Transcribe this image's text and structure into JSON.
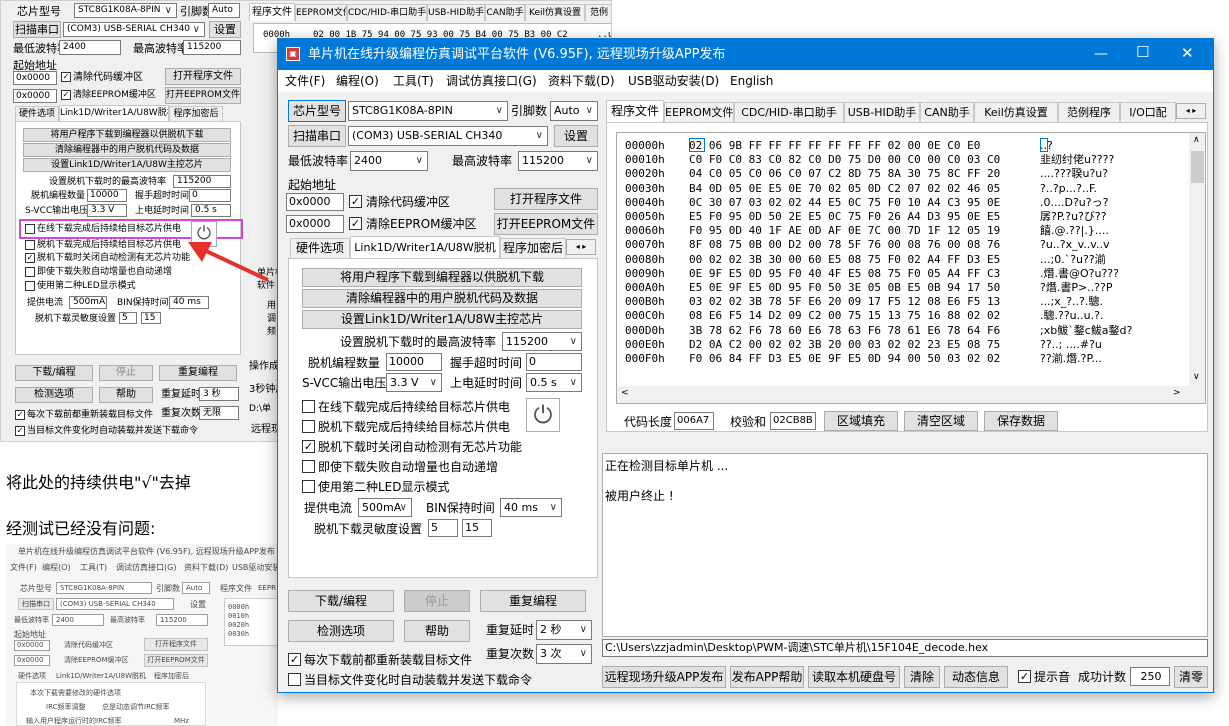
{
  "colors": {
    "accent": "#0078d7",
    "highlight": "#d646d6",
    "arrow": "#e8302a",
    "bg": "#f0f0f0"
  },
  "bgwin": {
    "chip_label": "芯片型号",
    "chip_value": "STC8G1K08A-8PIN",
    "pin_label": "引脚数",
    "pin_value": "Auto",
    "settings": "设置",
    "scan_port": "扫描串口",
    "port": "(COM3) USB-SERIAL CH340",
    "min_baud_label": "最低波特率",
    "min_baud": "2400",
    "max_baud_label": "最高波特率",
    "max_baud": "115200",
    "start_addr": "起始地址",
    "addr1": "0x0000",
    "clear_code": "清除代码缓冲区",
    "open_prog": "打开程序文件",
    "addr2": "0x0000",
    "clear_eeprom": "清除EEPROM缓冲区",
    "open_eeprom": "打开EEPROM文件",
    "tabs": [
      "硬件选项",
      "Link1D/Writer1A/U8W脱机",
      "程序加密后"
    ],
    "btn1": "将用户程序下载到编程器以供脱机下载",
    "btn2": "清除编程器中的用户脱机代码及数据",
    "btn3": "设置Link1D/Writer1A/U8W主控芯片",
    "max_baud_offline": "设置脱机下载时的最高波特率",
    "max_baud_offline_v": "115200",
    "off_count": "脱机编程数量",
    "off_count_v": "10000",
    "timeout": "握手超时时间",
    "timeout_v": "0",
    "svcc": "S-VCC输出电压",
    "svcc_v": "3.3 V",
    "updelay": "上电延时时间",
    "updelay_v": "0.5 s",
    "opt1": "在线下载完成后持续给目标芯片供电",
    "opt2": "脱机下载完成后持续给目标芯片供电",
    "opt3": "脱机下载时关闭自动检测有无芯片功能",
    "opt4": "即使下载失败自动增量也自动递增",
    "opt5": "使用第二种LED显示模式",
    "current": "提供电流",
    "current_v": "500mA",
    "bin_hold": "BIN保持时间",
    "bin_hold_v": "40 ms",
    "sens": "脱机下载灵敏度设置",
    "sens1": "5",
    "sens2": "15",
    "download": "下载/编程",
    "stop": "停止",
    "reprog": "重复编程",
    "check": "检测选项",
    "help": "帮助",
    "redelay": "重复延时",
    "redelay_v": "3 秒",
    "recount": "重复次数",
    "recount_v": "无限",
    "reload": "每次下载前都重新装载目标文件",
    "autosend": "当目标文件变化时自动装载并发送下载命令",
    "tabs_right": [
      "程序文件",
      "EEPROM文件",
      "CDC/HID-串口助手",
      "USB-HID助手",
      "CAN助手",
      "Keil仿真设置",
      "范例"
    ],
    "hex_addr": "0000h",
    "hex_peek": "02 00 1B 75 94 00 75 93 00 75 B4 00 75 B3 00 C2",
    "peek_ascii": "..u?u",
    "right_labels": [
      "单片机",
      "软件",
      "用",
      "调",
      "频",
      "操作成",
      "3秒钟后",
      "D:\\单",
      "远程现"
    ]
  },
  "note_text": "将此处的持续供电\"√\"去掉",
  "tested_text": "经测试已经没有问题:",
  "thumb": {
    "title": "单片机在线升级编程仿真调试平台软件 (V6.95F), 远程现场升级APP发布",
    "menu": [
      "文件(F)",
      "编程(O)",
      "工具(T)",
      "调试仿真接口(G)",
      "资料下载(D)",
      "USB驱动安装"
    ],
    "chip_label": "芯片型号",
    "chip_value": "STC8G1K08A-8PIN",
    "pin_label": "引脚数",
    "pin_value": "Auto",
    "tab_prog": "程序文件",
    "tab_eep": "EEPR",
    "scan_port": "扫描串口",
    "port": "(COM3) USB-SERIAL CH340",
    "settings": "设置",
    "min_baud_label": "最低波特率",
    "min_baud": "2400",
    "max_baud_label": "最高波特率",
    "max_baud": "115200",
    "start_addr": "起始地址",
    "addr1": "0x0000",
    "clear_code": "清除代码缓冲区",
    "open_prog": "打开程序文件",
    "addr2": "0x0000",
    "clear_eeprom": "清除EEPROM缓冲区",
    "open_eeprom": "打开EEPROM文件",
    "tabs": [
      "硬件选项",
      "Link1D/Writer1A/U8W脱机",
      "程序加密后"
    ],
    "opt1": "本次下载需要修改的硬件选项",
    "opt2": "IRC频率调整",
    "opt2_v": "总是动态调节IRC频率",
    "opt3": "输入用户程序运行时的IRC频率",
    "opt3_v": "MHz",
    "hex_rows": [
      "0000h",
      "0010h",
      "0020h",
      "0030h"
    ]
  },
  "main": {
    "title": "单片机在线升级编程仿真调试平台软件 (V6.95F), 远程现场升级APP发布",
    "win_min": "—",
    "win_max": "☐",
    "win_close": "✕",
    "menu": [
      "文件(F)",
      "编程(O)",
      "工具(T)",
      "调试仿真接口(G)",
      "资料下载(D)",
      "USB驱动安装(D)",
      "English"
    ],
    "chip_label": "芯片型号",
    "chip_value": "STC8G1K08A-8PIN",
    "pin_label": "引脚数",
    "pin_value": "Auto",
    "scan_port": "扫描串口",
    "port": "(COM3) USB-SERIAL CH340",
    "settings": "设置",
    "min_baud_label": "最低波特率",
    "min_baud": "2400",
    "max_baud_label": "最高波特率",
    "max_baud": "115200",
    "start_addr": "起始地址",
    "addr1": "0x0000",
    "clear_code": "清除代码缓冲区",
    "open_prog": "打开程序文件",
    "addr2": "0x0000",
    "clear_eeprom": "清除EEPROM缓冲区",
    "open_eeprom": "打开EEPROM文件",
    "left_tabs": [
      "硬件选项",
      "Link1D/Writer1A/U8W脱机",
      "程序加密后"
    ],
    "btn_download_offline": "将用户程序下载到编程器以供脱机下载",
    "btn_clear_offline": "清除编程器中的用户脱机代码及数据",
    "btn_set_master": "设置Link1D/Writer1A/U8W主控芯片",
    "max_baud_offline_label": "设置脱机下载时的最高波特率",
    "max_baud_offline": "115200",
    "offline_count_label": "脱机编程数量",
    "offline_count": "10000",
    "handshake_label": "握手超时时间",
    "handshake": "0",
    "svcc_label": "S-VCC输出电压",
    "svcc": "3.3 V",
    "powerup_label": "上电延时时间",
    "powerup": "0.5 s",
    "opt_online_power": "在线下载完成后持续给目标芯片供电",
    "opt_offline_power": "脱机下载完成后持续给目标芯片供电",
    "opt_no_detect": "脱机下载时关闭自动检测有无芯片功能",
    "opt_increment": "即使下载失败自动增量也自动递增",
    "opt_led2": "使用第二种LED显示模式",
    "current_label": "提供电流",
    "current": "500mA",
    "binhold_label": "BIN保持时间",
    "binhold": "40 ms",
    "sens_label": "脱机下载灵敏度设置",
    "sens1": "5",
    "sens2": "15",
    "download": "下载/编程",
    "stop": "停止",
    "reprogram": "重复编程",
    "check_options": "检测选项",
    "help": "帮助",
    "repeat_delay_label": "重复延时",
    "repeat_delay": "2 秒",
    "repeat_count_label": "重复次数",
    "repeat_count": "3 次",
    "reload_before": "每次下载前都重新装载目标文件",
    "auto_send": "当目标文件变化时自动装载并发送下载命令",
    "right_tabs": [
      "程序文件",
      "EEPROM文件",
      "CDC/HID-串口助手",
      "USB-HID助手",
      "CAN助手",
      "Keil仿真设置",
      "范例程序",
      "I/O口配"
    ],
    "hex": [
      {
        "addr": "00000h",
        "bytes": "02 06 9B FF FF FF FF FF FF FF 02 00 0E C0 E0",
        "ascii": "..?"
      },
      {
        "addr": "00010h",
        "bytes": "C0 F0 C0 83 C0 82 C0 D0 75 D0 00 C0 00 C0 03 C0",
        "ascii": "韭纫纣佬u????"
      },
      {
        "addr": "00020h",
        "bytes": "04 C0 05 C0 06 C0 07 C2 8D 75 8A 30 75 8C FF 20",
        "ascii": "....???聧u?u?"
      },
      {
        "addr": "00030h",
        "bytes": "B4 0D 05 0E E5 0E 70 02 05 0D C2 07 02 02 46 05",
        "ascii": "?..?p...?..F."
      },
      {
        "addr": "00040h",
        "bytes": "0C 30 07 03 02 02 44 E5 0C 75 F0 10 A4 C3 95 0E",
        "ascii": ".0....D?u?っ?"
      },
      {
        "addr": "00050h",
        "bytes": "E5 F0 95 0D 50 2E E5 0C 75 F0 26 A4 D3 95 0E E5",
        "ascii": "孱?P.?u?び??"
      },
      {
        "addr": "00060h",
        "bytes": "F0 95 0D 40 1F AE 0D AF 0E 7C 00 7D 1F 12 05 19",
        "ascii": "饎.@.??|.}...."
      },
      {
        "addr": "00070h",
        "bytes": "8F 08 75 0B 00 D2 00 78 5F 76 00 08 76 00 08 76",
        "ascii": "?u..?x_v..v..v"
      },
      {
        "addr": "00080h",
        "bytes": "00 02 02 3B 30 00 60 E5 08 75 F0 02 A4 FF D3 E5",
        "ascii": "...;0.`?u??湔"
      },
      {
        "addr": "00090h",
        "bytes": "0E 9F E5 0D 95 F0 40 4F E5 08 75 F0 05 A4 FF C3",
        "ascii": ".熸.書@O?u???"
      },
      {
        "addr": "000A0h",
        "bytes": "E5 0E 9F E5 0D 95 F0 50 3E 05 0B E5 0B 94 17 50",
        "ascii": "?熸.書P>..??P"
      },
      {
        "addr": "000B0h",
        "bytes": "03 02 02 3B 78 5F E6 20 09 17 F5 12 08 E6 F5 13",
        "ascii": "...;x_?..?.驄."
      },
      {
        "addr": "000C0h",
        "bytes": "08 E6 F5 14 D2 09 C2 00 75 15 13 75 16 88 02 02",
        "ascii": ".驄.??u..u.?."
      },
      {
        "addr": "000D0h",
        "bytes": "3B 78 62 F6 78 60 E6 78 63 F6 78 61 E6 78 64 F6",
        "ascii": ";xb鲅`鍪c鲅a鍪d?"
      },
      {
        "addr": "000E0h",
        "bytes": "D2 0A C2 00 02 02 3B 20 00 03 02 02 23 E5 08 75",
        "ascii": "??..; ....#?u"
      },
      {
        "addr": "000F0h",
        "bytes": "F0 06 84 FF D3 E5 0E 9F E5 0D 94 00 50 03 02 02",
        "ascii": "??湔.熸.?P..."
      }
    ],
    "code_len_label": "代码长度",
    "code_len": "006A7",
    "checksum_label": "校验和",
    "checksum": "02CB8B",
    "fill_area": "区域填充",
    "clear_area": "清空区域",
    "save_data": "保存数据",
    "log1": "正在检测目标单片机 ...",
    "log2": "被用户终止 !",
    "path": "C:\\Users\\zzjadmin\\Desktop\\PWM-调速\\STC单片机\\15F104E_decode.hex",
    "remote_app": "远程现场升级APP发布",
    "app_help": "发布APP帮助",
    "read_serial": "读取本机硬盘号",
    "clear": "清除",
    "dynamic": "动态信息",
    "beep": "提示音",
    "success_label": "成功计数",
    "success": "250",
    "reset": "清零"
  }
}
